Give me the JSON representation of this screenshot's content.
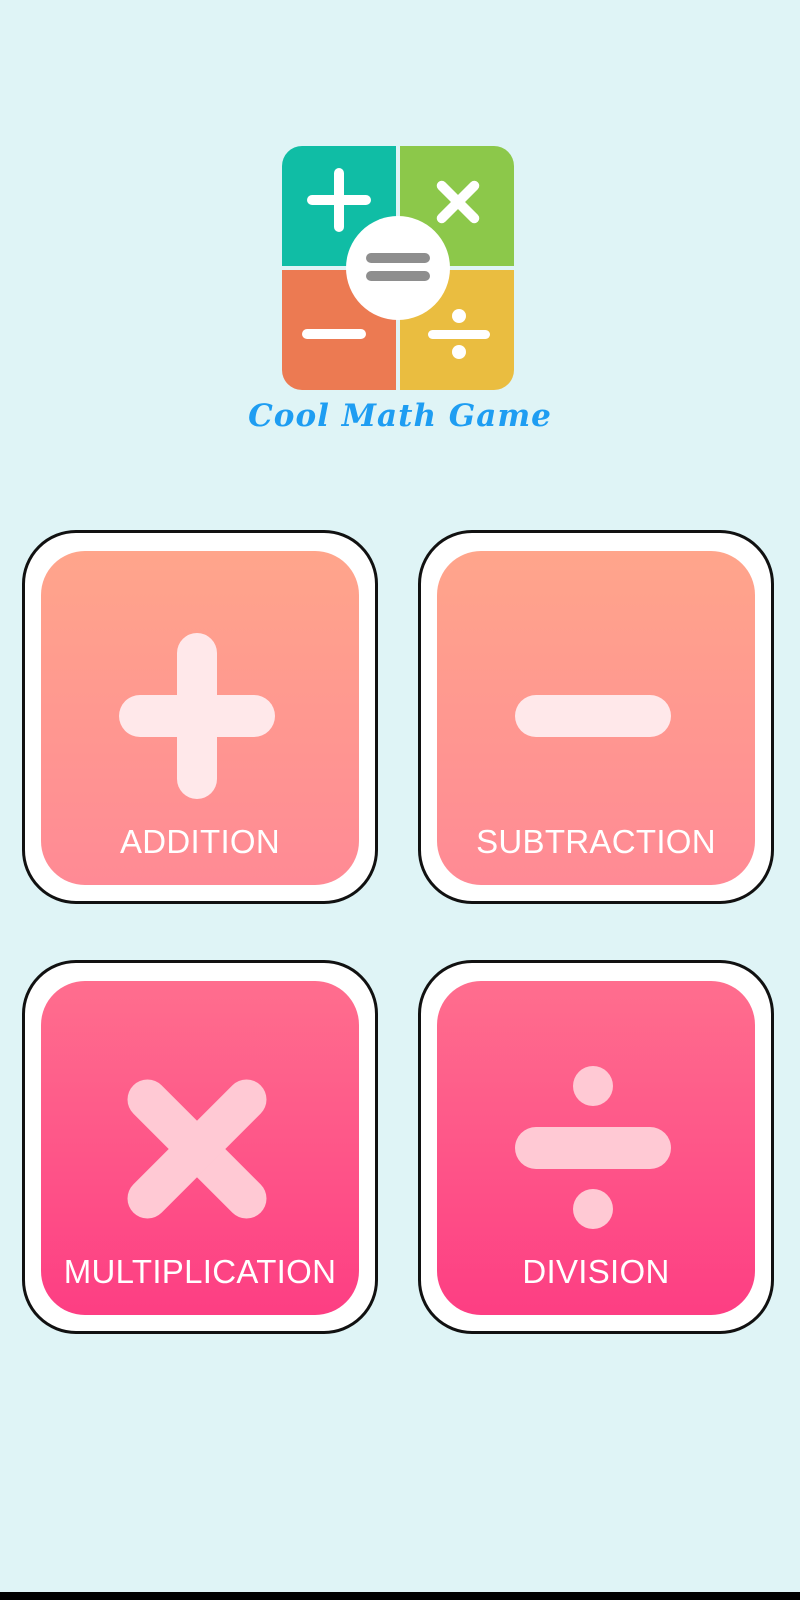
{
  "app": {
    "logo_icon": "math-operators-logo",
    "logo_text": "Cool Math Game"
  },
  "menu": {
    "items": [
      {
        "label": "ADDITION",
        "icon": "plus-icon"
      },
      {
        "label": "SUBTRACTION",
        "icon": "minus-icon"
      },
      {
        "label": "MULTIPLICATION",
        "icon": "multiply-icon"
      },
      {
        "label": "DIVISION",
        "icon": "divide-icon"
      }
    ]
  },
  "colors": {
    "background": "#dff4f6",
    "logo_text": "#1e9df2",
    "card_top_gradient": [
      "#ffa58b",
      "#ff8a95"
    ],
    "card_bottom_gradient": [
      "#ff6e8e",
      "#fd3e83"
    ],
    "logo_teal": "#10bda5",
    "logo_green": "#8cc84a",
    "logo_orange": "#ec7a52",
    "logo_yellow": "#eabd40"
  }
}
